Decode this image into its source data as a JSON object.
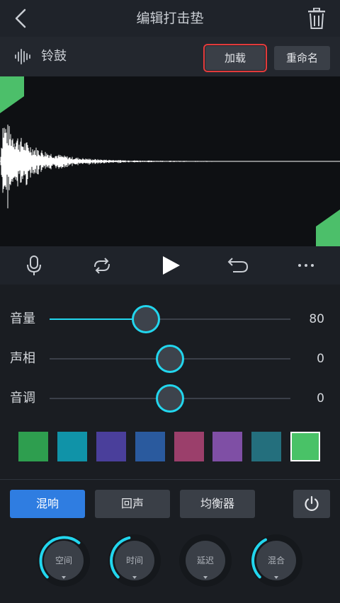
{
  "header": {
    "title": "编辑打击垫",
    "back_icon": "chevron-left-icon",
    "delete_icon": "trash-icon"
  },
  "pad": {
    "name": "铃鼓",
    "icon": "waveform-icon",
    "load_label": "加载",
    "rename_label": "重命名"
  },
  "transport": {
    "icons": [
      "microphone-icon",
      "loop-icon",
      "play-icon",
      "undo-icon",
      "more-icon"
    ]
  },
  "sliders": [
    {
      "label": "音量",
      "value": "80",
      "level": 0.4
    },
    {
      "label": "声相",
      "value": "0",
      "level": 0.5
    },
    {
      "label": "音调",
      "value": "0",
      "level": 0.5
    }
  ],
  "swatches": [
    "#2e9e4f",
    "#1093a8",
    "#4a3f9b",
    "#2a5a9e",
    "#9b3f6b",
    "#7f4fa5",
    "#246f7d",
    "#49c267"
  ],
  "selected_swatch": 7,
  "effect_tabs": [
    {
      "label": "混响",
      "active": true
    },
    {
      "label": "回声",
      "active": false
    },
    {
      "label": "均衡器",
      "active": false
    }
  ],
  "power_icon": "power-icon",
  "knobs": [
    {
      "label": "空间",
      "level": 0.65
    },
    {
      "label": "时间",
      "level": 0.45
    },
    {
      "label": "延迟",
      "level": 0.0
    },
    {
      "label": "混合",
      "level": 0.4
    }
  ],
  "colors": {
    "accent": "#22d6ee",
    "active_tab": "#2f7de1",
    "marker_green": "#4cbf6a",
    "highlight_outline": "#e23b3b"
  }
}
